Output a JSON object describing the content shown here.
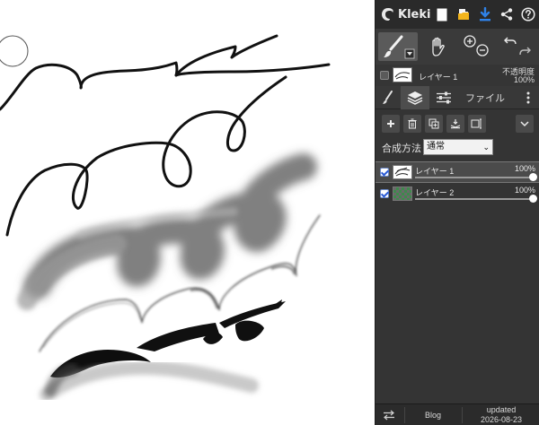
{
  "app": {
    "name": "Kleki"
  },
  "topbar": {
    "icons": [
      "kleki-logo-icon",
      "new-image-icon",
      "open-folder-icon",
      "download-icon",
      "share-icon",
      "help-icon"
    ],
    "accent": "#2f82e8"
  },
  "toolbar": {
    "tools": [
      "brush-tool-icon",
      "hand-tool-icon",
      "zoom-in-icon",
      "zoom-out-icon",
      "undo-icon",
      "redo-icon"
    ]
  },
  "current_layer": {
    "name": "レイヤー 1",
    "opacity_label": "不透明度",
    "opacity_value": "100%"
  },
  "tabs": [
    {
      "label": "",
      "icon": "brush-icon"
    },
    {
      "label": "",
      "icon": "layers-icon"
    },
    {
      "label": "",
      "icon": "sliders-icon"
    },
    {
      "label": "ファイル"
    },
    {
      "label": "",
      "icon": "more-vertical-icon"
    }
  ],
  "layer_actions": [
    "add-layer-icon",
    "delete-layer-icon",
    "duplicate-layer-icon",
    "merge-down-icon",
    "layer-options-icon",
    "collapse-chevron-icon"
  ],
  "blend": {
    "label": "合成方法",
    "value": "通常"
  },
  "layers": [
    {
      "name": "レイヤー 1",
      "opacity": "100%",
      "active": true
    },
    {
      "name": "レイヤー 2",
      "opacity": "100%",
      "active": false
    }
  ],
  "bottom": {
    "blog": "Blog",
    "updated_label": "updated",
    "updated_date": "2026-08-23"
  }
}
